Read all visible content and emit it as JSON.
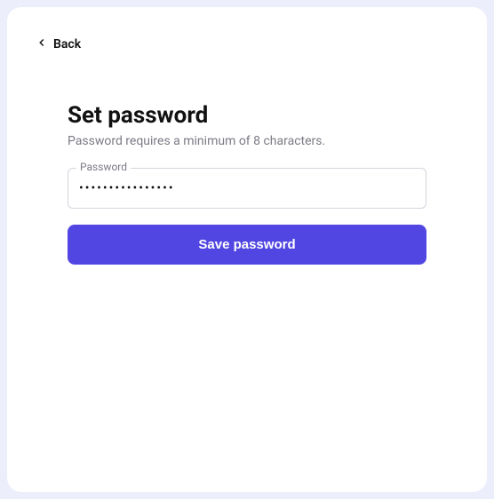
{
  "nav": {
    "back_label": "Back"
  },
  "page": {
    "title": "Set password",
    "subtitle": "Password requires a minimum of 8 characters."
  },
  "form": {
    "password_label": "Password",
    "password_value": "••••••••••••••••",
    "save_label": "Save password"
  },
  "colors": {
    "accent": "#5246e2"
  }
}
